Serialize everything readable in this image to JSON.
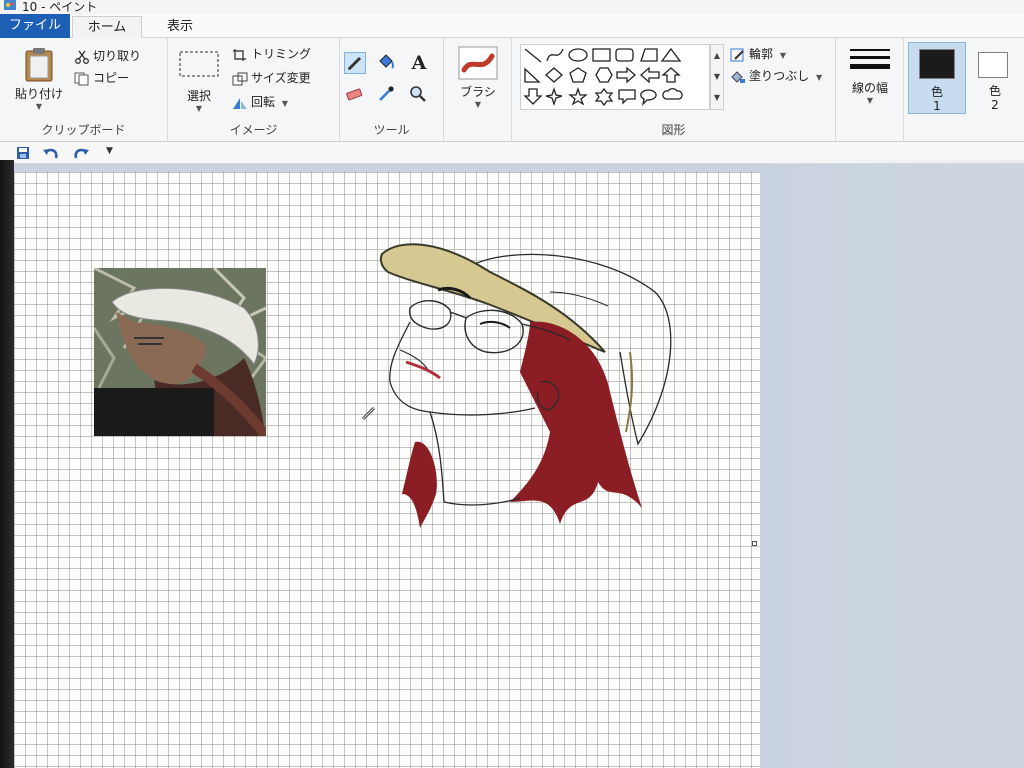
{
  "window": {
    "title": "10 - ペイント"
  },
  "tabs": [
    {
      "label": "ファイル"
    },
    {
      "label": "ホーム"
    },
    {
      "label": "表示"
    }
  ],
  "clipboard": {
    "paste_label": "貼り付け",
    "cut_label": "切り取り",
    "copy_label": "コピー",
    "group_label": "クリップボード"
  },
  "image": {
    "select_label": "選択",
    "crop_label": "トリミング",
    "resize_label": "サイズ変更",
    "rotate_label": "回転",
    "group_label": "イメージ"
  },
  "tools": {
    "group_label": "ツール",
    "text_glyph": "A"
  },
  "brush": {
    "label": "ブラシ"
  },
  "shapes": {
    "group_label": "図形",
    "outline_label": "輪郭",
    "fill_label": "塗りつぶし"
  },
  "stroke": {
    "label": "線の幅"
  },
  "colors": {
    "color1_label": "色",
    "color1_num": "1",
    "color2_label": "色",
    "color2_num": "2",
    "color1_value": "#1b1b1b",
    "color2_value": "#ffffff"
  },
  "palette": {
    "accent": "#1d5fb5",
    "hair": "#8b1e24",
    "cap": "#d6c891",
    "outline": "#2a2a2a"
  }
}
